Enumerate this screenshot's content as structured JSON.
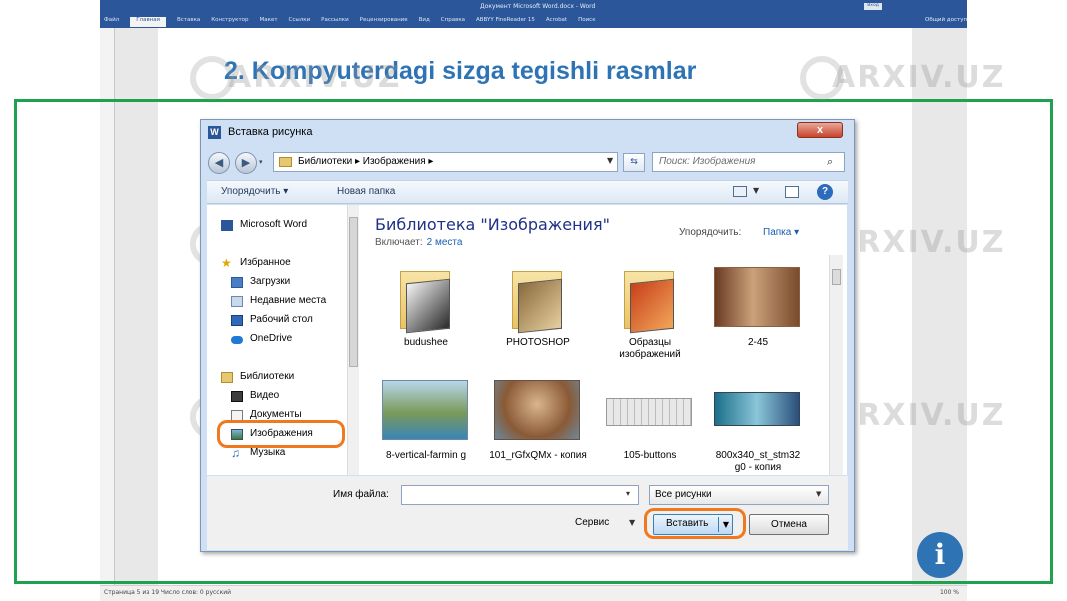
{
  "word": {
    "title": "Документ Microsoft Word.docx - Word",
    "login": "Вход",
    "share": "Общий доступ",
    "tabs": [
      "Файл",
      "Главная",
      "Вставка",
      "Конструктор",
      "Макет",
      "Ссылки",
      "Рассылки",
      "Рецензирование",
      "Вид",
      "Справка",
      "ABBYY FineReader 15",
      "Acrobat",
      "Поиск"
    ],
    "status_left": "Страница 5 из 19     Число слов: 0     русский",
    "status_zoom": "100 %"
  },
  "slide": {
    "title": "2. Kompyuterdagi sizga tegishli rasmlar"
  },
  "dialog": {
    "title": "Вставка рисунка",
    "close": "x",
    "address": "Библиотеки  ▸  Изображения  ▸",
    "search_placeholder": "Поиск: Изображения",
    "toolbar": {
      "organize": "Упорядочить  ▾",
      "new_folder": "Новая папка"
    },
    "nav": [
      {
        "label": "Microsoft Word",
        "icon": "word-icon"
      },
      {
        "label": "Избранное",
        "icon": "star-icon"
      },
      {
        "label": "Загрузки",
        "icon": "downloads-icon"
      },
      {
        "label": "Недавние места",
        "icon": "recent-places-icon"
      },
      {
        "label": "Рабочий стол",
        "icon": "desktop-icon"
      },
      {
        "label": "OneDrive",
        "icon": "cloud-icon"
      },
      {
        "label": "Библиотеки",
        "icon": "libraries-icon"
      },
      {
        "label": "Видео",
        "icon": "video-icon"
      },
      {
        "label": "Документы",
        "icon": "documents-icon"
      },
      {
        "label": "Изображения",
        "icon": "pictures-icon"
      },
      {
        "label": "Музыка",
        "icon": "music-icon"
      }
    ],
    "library": {
      "title": "Библиотека \"Изображения\"",
      "includes_label": "Включает:",
      "includes_link": "2 места",
      "arrange_label": "Упорядочить:",
      "arrange_value": "Папка  ▾"
    },
    "items": [
      {
        "label": "budushee",
        "kind": "folder"
      },
      {
        "label": "PHOTOSHOP",
        "kind": "folder"
      },
      {
        "label": "Образцы изображений",
        "kind": "folder"
      },
      {
        "label": "2-45",
        "kind": "image"
      },
      {
        "label": "8-vertical-farmin g",
        "kind": "image"
      },
      {
        "label": "101_rGfxQMx - копия",
        "kind": "image"
      },
      {
        "label": "105-buttons",
        "kind": "image"
      },
      {
        "label": "800x340_st_stm32 g0 - копия",
        "kind": "image"
      }
    ],
    "filename_label": "Имя файла:",
    "filename_value": "",
    "filter_value": "Все рисунки",
    "tools_label": "Сервис",
    "insert_label": "Вставить",
    "cancel_label": "Отмена"
  },
  "watermark": "ARXIV.UZ",
  "info_badge": "i",
  "colors": {
    "frame": "#1fa14f",
    "title": "#2e74b5",
    "highlight": "#f0781e",
    "word_blue": "#2b579a"
  }
}
